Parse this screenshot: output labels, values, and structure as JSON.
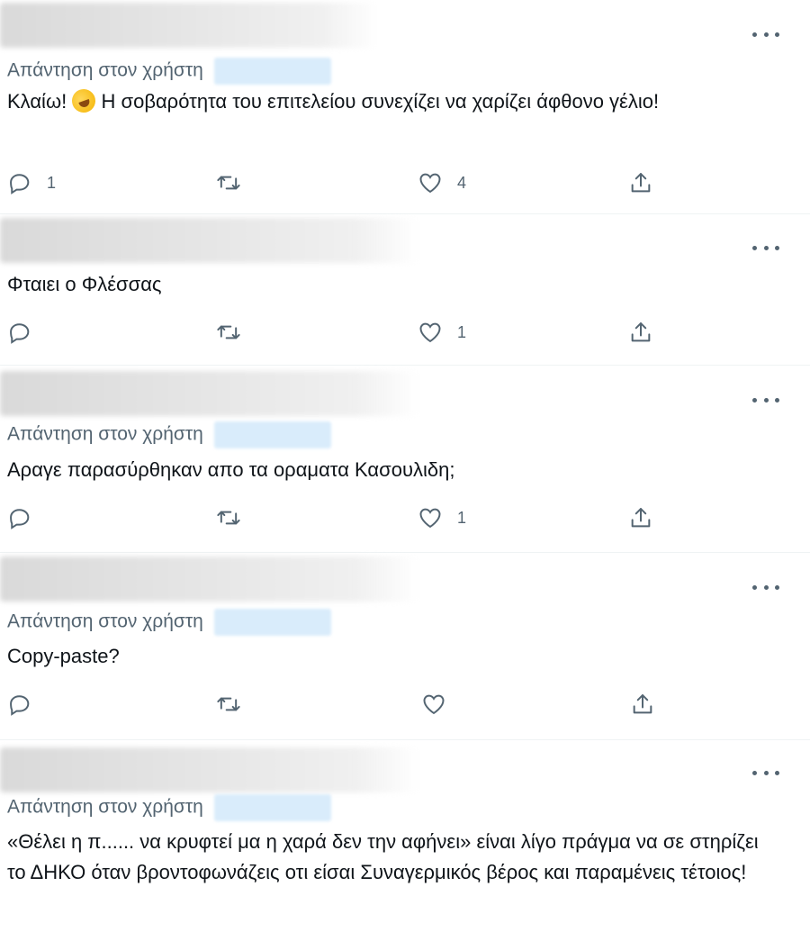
{
  "tweets": [
    {
      "reply_label": "Απάντηση στον χρήστη",
      "mention_visible_char": "@",
      "text": "Κλαίω! 🤣 Η σοβαρότητα του επιτελείου συνεχίζει να χαρίζει άφθονο γέλιο!",
      "text_before_emoji": "Κλαίω!",
      "text_after_emoji": "Η σοβαρότητα του επιτελείου συνεχίζει να χαρίζει άφθονο γέλιο!",
      "reply_count": "1",
      "retweet_count": "",
      "like_count": "4"
    },
    {
      "reply_label": "",
      "text": "Φταιει ο Φλέσσας",
      "reply_count": "",
      "retweet_count": "",
      "like_count": "1"
    },
    {
      "reply_label": "Απάντηση στον χρήστη",
      "mention_visible_char": "@",
      "text": "Αραγε παρασύρθηκαν απο τα οραματα Κασουλιδη;",
      "reply_count": "",
      "retweet_count": "",
      "like_count": "1"
    },
    {
      "reply_label": "Απάντηση στον χρήστη",
      "text": "Copy-paste?",
      "reply_count": "",
      "retweet_count": "",
      "like_count": ""
    },
    {
      "reply_label": "Απάντηση στον χρήστη",
      "text": "«Θέλει η π...... να κρυφτεί μα η χαρά δεν την αφήνει» είναι λίγο πράγμα να σε στηρίζει το ΔΗΚΟ όταν βροντοφωνάζεις οτι είσαι Συναγερμικός βέρος και παραμένεις τέτοιος!",
      "reply_count": "",
      "retweet_count": "",
      "like_count": ""
    }
  ],
  "icons": {
    "reply": "reply-icon",
    "retweet": "retweet-icon",
    "like": "heart-icon",
    "share": "share-icon",
    "more": "more-options-icon"
  },
  "colors": {
    "text": "#0f1419",
    "secondary": "#536471",
    "mention_blur": "#d9ecfb",
    "divider": "#eff3f4"
  }
}
